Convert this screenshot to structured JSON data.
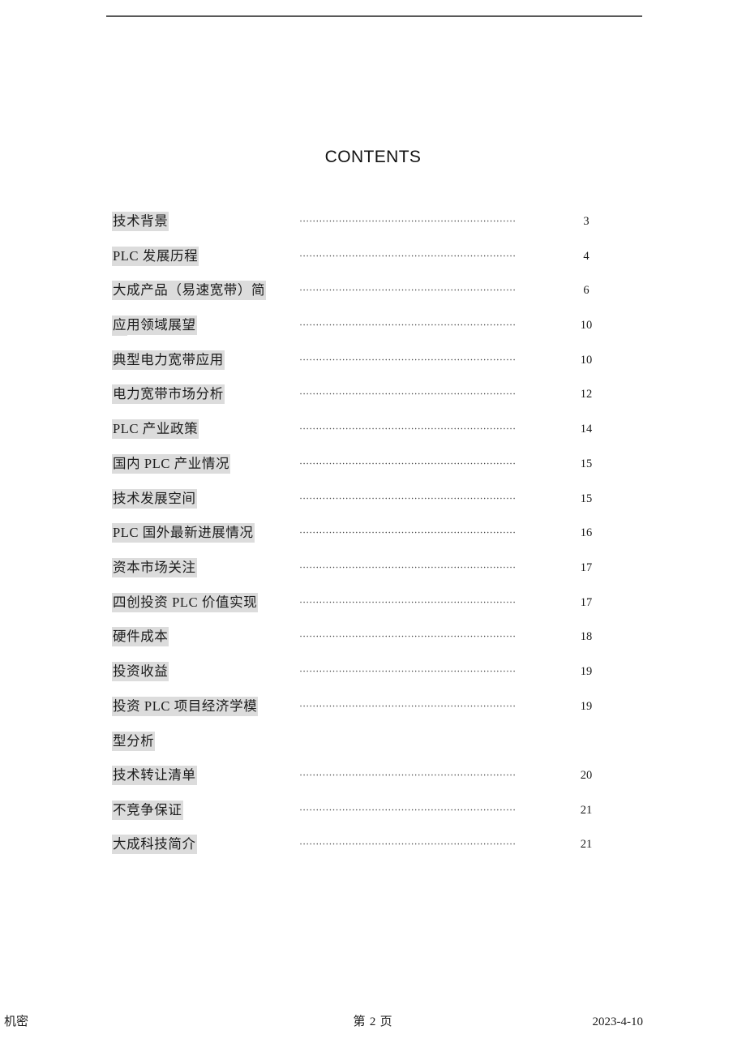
{
  "document": {
    "title": "CONTENTS",
    "highlight_color": "#dcdcdc",
    "rule_color": "#595959",
    "text_color": "#1c1c1c"
  },
  "toc": {
    "entries": [
      {
        "label": "技术背景",
        "page": "3"
      },
      {
        "label": "PLC 发展历程",
        "page": "4"
      },
      {
        "label": "大成产品（易速宽带）简介",
        "page": "6"
      },
      {
        "label": "应用领域展望",
        "page": "10"
      },
      {
        "label": "典型电力宽带应用",
        "page": "10"
      },
      {
        "label": "电力宽带市场分析",
        "page": "12"
      },
      {
        "label": "PLC 产业政策",
        "page": "14"
      },
      {
        "label": "国内 PLC 产业情况",
        "page": "15"
      },
      {
        "label": "技术发展空间",
        "page": "15"
      },
      {
        "label": "PLC 国外最新进展情况",
        "page": "16"
      },
      {
        "label": "资本市场关注",
        "page": "17"
      },
      {
        "label": "四创投资 PLC 价值实现",
        "page": "17"
      },
      {
        "label": "硬件成本",
        "page": "18"
      },
      {
        "label": "投资收益",
        "page": "19"
      },
      {
        "label": "投资 PLC 项目经济学模型分析",
        "page": "19",
        "wraps": true
      },
      {
        "label": "技术转让清单",
        "page": "20"
      },
      {
        "label": "不竞争保证",
        "page": "21"
      },
      {
        "label": "大成科技简介",
        "page": "21"
      }
    ]
  },
  "footer": {
    "left": "机密",
    "center": "第 2 页",
    "right": "2023-4-10"
  }
}
